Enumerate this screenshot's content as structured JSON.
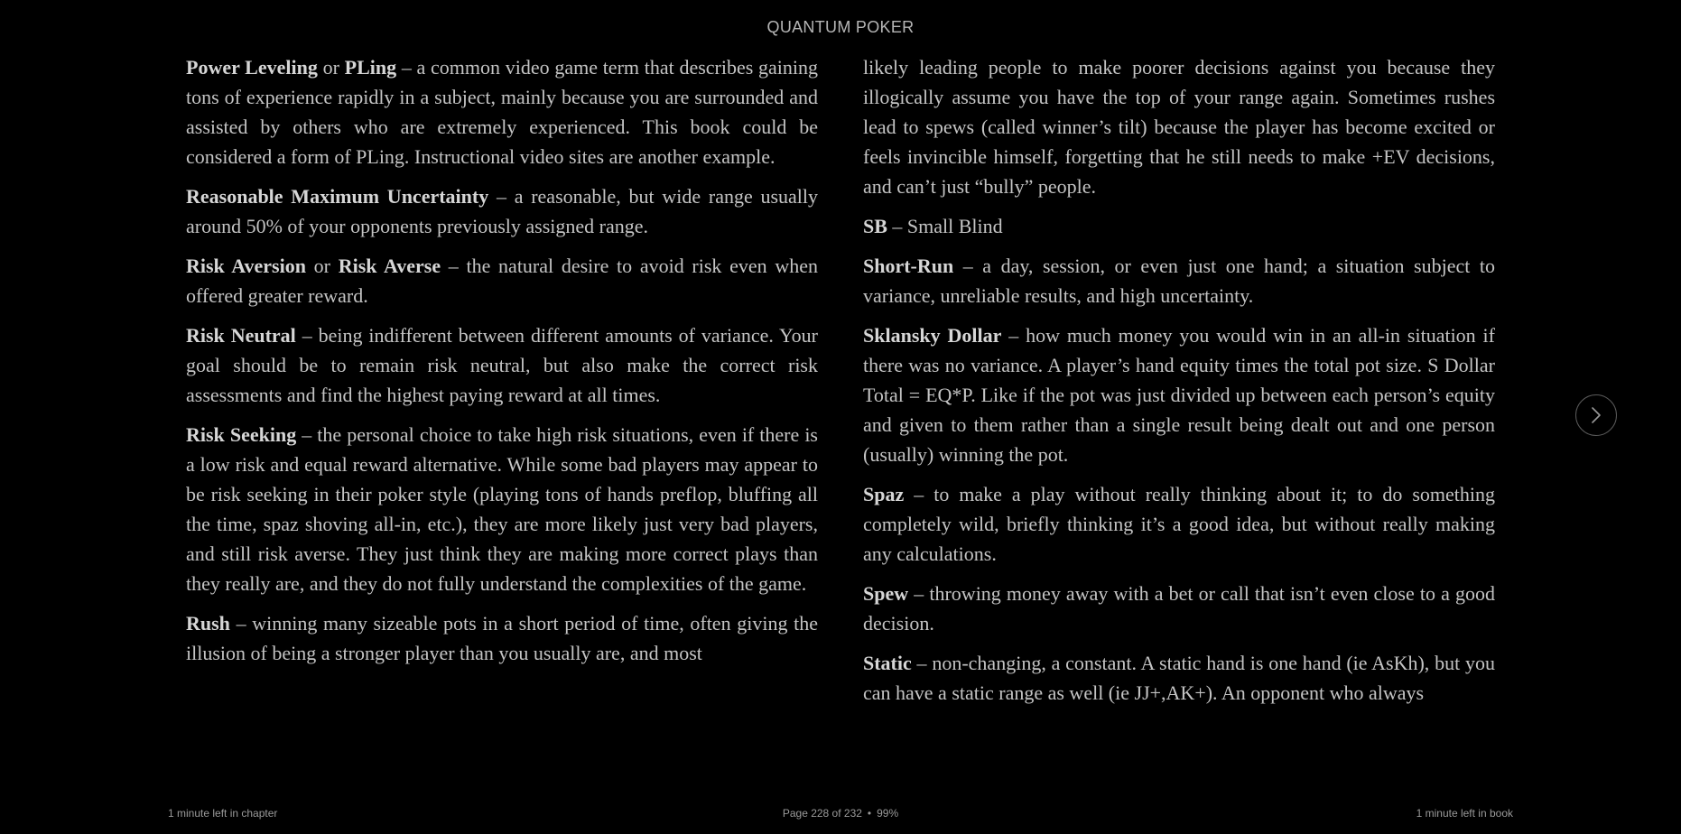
{
  "header": {
    "title": "QUANTUM POKER"
  },
  "left_column": [
    {
      "parts": [
        {
          "t": "Power Leveling",
          "b": true
        },
        {
          "t": " or ",
          "b": false
        },
        {
          "t": "PLing",
          "b": true
        },
        {
          "t": " – a common video game term that describes gaining tons of experience rapidly in a subject, mainly because you are surrounded and assisted by others who are extremely experienced. This book could be considered a form of PLing. Instructional video sites are another example.",
          "b": false
        }
      ]
    },
    {
      "parts": [
        {
          "t": "Reasonable Maximum Uncertainty",
          "b": true
        },
        {
          "t": " – a reasonable, but wide range usually around 50% of your opponents previously assigned range.",
          "b": false
        }
      ]
    },
    {
      "parts": [
        {
          "t": "Risk Aversion",
          "b": true
        },
        {
          "t": " or ",
          "b": false
        },
        {
          "t": "Risk Averse",
          "b": true
        },
        {
          "t": " – the natural desire to avoid risk even when offered greater reward.",
          "b": false
        }
      ]
    },
    {
      "parts": [
        {
          "t": "Risk Neutral",
          "b": true
        },
        {
          "t": " – being indifferent between different amounts of variance. Your goal should be to remain risk neutral, but also make the correct risk assessments and find the highest paying reward at all times.",
          "b": false
        }
      ]
    },
    {
      "parts": [
        {
          "t": "Risk Seeking",
          "b": true
        },
        {
          "t": " – the personal choice to take high risk situations, even if there is a low risk and equal reward alternative. While some bad players may appear to be risk seeking in their poker style (playing tons of hands preflop, bluffing all the time, spaz shoving all-in, etc.), they are more likely just very bad players, and still risk averse. They just think they are making more correct plays than they really are, and they do not fully understand the complexities of the game.",
          "b": false
        }
      ]
    },
    {
      "parts": [
        {
          "t": "Rush",
          "b": true
        },
        {
          "t": " – winning many sizeable pots in a short period of time, often giving the illusion of being a stronger player than you usually are, and most",
          "b": false
        }
      ]
    }
  ],
  "right_column": [
    {
      "parts": [
        {
          "t": "likely leading people to make poorer decisions against you because they illogically assume you have the top of your range again. Sometimes rushes lead to spews (called winner’s tilt) because the player has become excited or feels invincible himself, forgetting that he still needs to make +EV decisions, and can’t just “bully” people.",
          "b": false
        }
      ]
    },
    {
      "parts": [
        {
          "t": "SB",
          "b": true
        },
        {
          "t": " – Small Blind",
          "b": false
        }
      ]
    },
    {
      "parts": [
        {
          "t": "Short-Run",
          "b": true
        },
        {
          "t": " – a day, session, or even just one hand; a situation subject to variance, unreliable results, and high uncertainty.",
          "b": false
        }
      ]
    },
    {
      "parts": [
        {
          "t": "Sklansky Dollar",
          "b": true
        },
        {
          "t": " – how much money you would win in an all-in situation if there was no variance. A player’s hand equity times the total pot size. S Dollar Total = EQ*P. Like if the pot was just divided up between each person’s equity and given to them rather than a single result being dealt out and one person (usually) winning the pot.",
          "b": false
        }
      ]
    },
    {
      "parts": [
        {
          "t": "Spaz",
          "b": true
        },
        {
          "t": " – to make a play without really thinking about it; to do something completely wild, briefly thinking it’s a good idea, but without really making any calculations.",
          "b": false
        }
      ]
    },
    {
      "parts": [
        {
          "t": "Spew",
          "b": true
        },
        {
          "t": " – throwing money away with a bet or call that isn’t even close to a good decision.",
          "b": false
        }
      ]
    },
    {
      "parts": [
        {
          "t": "Static",
          "b": true
        },
        {
          "t": " – non-changing, a constant. A static hand is one hand (ie AsKh), but you can have a static range as well (ie JJ+,AK+). An opponent who always",
          "b": false
        }
      ]
    }
  ],
  "footer": {
    "chapter_time": "1 minute left in chapter",
    "page_label": "Page 228 of 232",
    "separator": "•",
    "percent": "99%",
    "book_time": "1 minute left in book"
  },
  "nav": {
    "next_icon": "chevron-right-icon"
  },
  "colors": {
    "background": "#000000",
    "text": "#c4c4c4",
    "muted": "#9a9a9a"
  }
}
